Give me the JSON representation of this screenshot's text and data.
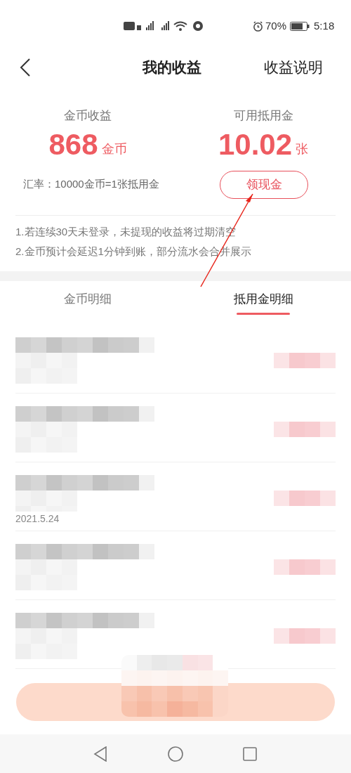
{
  "status_bar": {
    "battery_percent": "70%",
    "time": "5:18"
  },
  "header": {
    "title": "我的收益",
    "action": "收益说明"
  },
  "stats": [
    {
      "label": "金币收益",
      "value": "868",
      "unit": "金币"
    },
    {
      "label": "可用抵用金",
      "value": "10.02",
      "unit": "张"
    }
  ],
  "rate": "汇率：10000金币=1张抵用金",
  "withdraw_button": "领现金",
  "notes": [
    "1.若连续30天未登录，未提现的收益将过期清空",
    "2.金币预计会延迟1分钟到账，部分流水会合并展示"
  ],
  "tabs": [
    {
      "label": "金币明细",
      "selected": false
    },
    {
      "label": "抵用金明细",
      "selected": true
    }
  ],
  "rows": [
    {
      "kind": "redacted"
    },
    {
      "kind": "redacted"
    },
    {
      "kind": "redacted",
      "date": "2021.5.24"
    },
    {
      "kind": "redacted"
    },
    {
      "kind": "redacted"
    }
  ]
}
